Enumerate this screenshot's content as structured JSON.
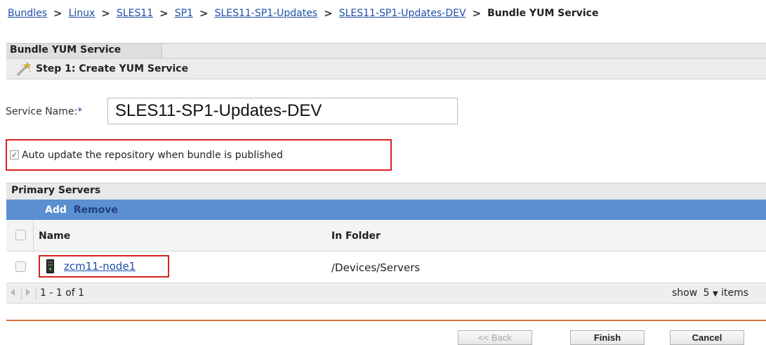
{
  "breadcrumb": {
    "links": [
      "Bundles",
      "Linux",
      "SLES11",
      "SP1",
      "SLES11-SP1-Updates",
      "SLES11-SP1-Updates-DEV"
    ],
    "separator": ">",
    "current": "Bundle YUM Service"
  },
  "tab": {
    "label": "Bundle YUM Service"
  },
  "step": {
    "title": "Step 1: Create YUM Service",
    "icon": "wand-icon"
  },
  "service_name": {
    "label": "Service Name:",
    "required_marker": "*",
    "value": "SLES11-SP1-Updates-DEV"
  },
  "auto_update": {
    "checked": true,
    "check_glyph": "✓",
    "label": "Auto update the repository when bundle is published"
  },
  "primary_servers": {
    "title": "Primary Servers",
    "toolbar": {
      "add_label": "Add",
      "remove_label": "Remove"
    },
    "columns": {
      "name": "Name",
      "folder": "In Folder"
    },
    "rows": [
      {
        "name": "zcm11-node1",
        "folder": "/Devices/Servers",
        "icon": "server-icon"
      }
    ],
    "pager": {
      "range": "1 - 1 of 1",
      "show_label": "show",
      "page_size": "5",
      "caret": "▼",
      "items_label": "items"
    }
  },
  "buttons": {
    "back": "<< Back",
    "finish": "Finish",
    "cancel": "Cancel"
  },
  "colors": {
    "link": "#1f4fa8",
    "toolbar": "#5b8fd0",
    "highlight": "#d9221c",
    "divider": "#e0703a"
  }
}
